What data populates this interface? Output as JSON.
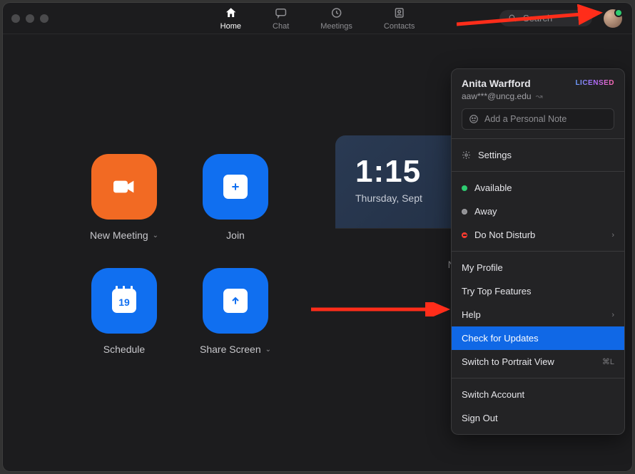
{
  "header": {
    "tabs": {
      "home": "Home",
      "chat": "Chat",
      "meetings": "Meetings",
      "contacts": "Contacts"
    },
    "search_placeholder": "Search"
  },
  "tiles": {
    "new_meeting": "New Meeting",
    "join": "Join",
    "schedule": "Schedule",
    "share_screen": "Share Screen",
    "calendar_day": "19"
  },
  "clock": {
    "time": "1:15",
    "date": "Thursday, Sept"
  },
  "no_upcoming": "No upcomin",
  "menu": {
    "name": "Anita Warfford",
    "email": "aaw***@uncg.edu",
    "licensed": "LICENSED",
    "note_placeholder": "Add a Personal Note",
    "settings": "Settings",
    "presence": {
      "available": "Available",
      "away": "Away",
      "dnd": "Do Not Disturb"
    },
    "my_profile": "My Profile",
    "try_top": "Try Top Features",
    "help": "Help",
    "check_updates": "Check for Updates",
    "portrait": "Switch to Portrait View",
    "portrait_kb": "⌘L",
    "switch_account": "Switch Account",
    "sign_out": "Sign Out"
  }
}
